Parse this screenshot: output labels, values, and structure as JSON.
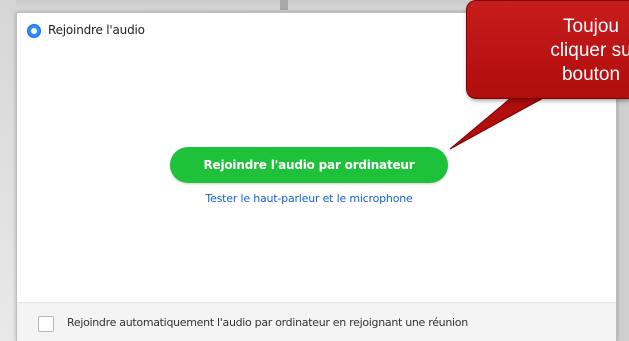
{
  "dialog": {
    "title": "Rejoindre l'audio",
    "join_button_label": "Rejoindre l'audio par ordinateur",
    "test_link_label": "Tester le haut-parleur et le microphone",
    "auto_join_checkbox": {
      "label": "Rejoindre automatiquement l'audio par ordinateur en rejoignant une réunion",
      "checked": false
    }
  },
  "callout": {
    "lines": [
      "Toujou",
      "cliquer su",
      "bouton"
    ]
  },
  "colors": {
    "join_button": "#1ec23a",
    "link": "#1463c9",
    "callout": "#b8141a",
    "title_icon": "#2d8cff"
  },
  "icons": {
    "title_icon": "zoom-logo-icon",
    "checkbox": "checkbox-icon"
  }
}
